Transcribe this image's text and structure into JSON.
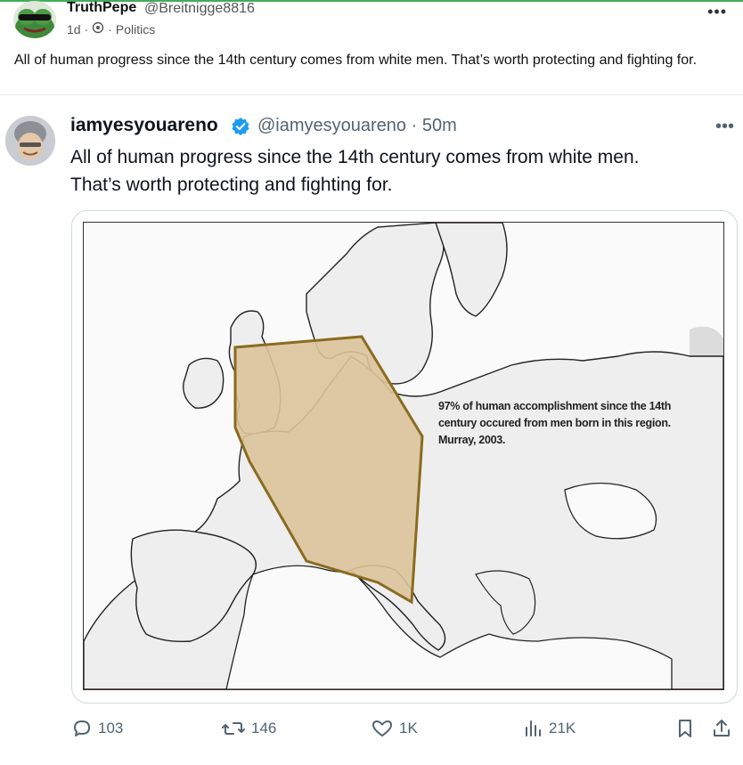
{
  "post": {
    "author_name": "TruthPepe",
    "author_handle": "@Breitnigge8816",
    "time": "1d",
    "community": "Politics",
    "text": "All of human progress since the 14th century comes from white men. That’s worth protecting and fighting for."
  },
  "quoted": {
    "display_name": "iamyesyouareno",
    "handle_time": "@iamyesyouareno · 50m",
    "text_line1": "All of human progress since the 14th century comes from white men.",
    "text_line2": "That’s worth protecting and fighting for.",
    "map_caption": [
      "97% of human accomplishment since the 14th",
      "century occured from men born in this region.",
      "Murray, 2003."
    ],
    "stats": {
      "replies": "103",
      "reposts": "146",
      "likes": "1K",
      "views": "21K"
    }
  },
  "icons": [
    "frog-avatar",
    "three-dots-icon",
    "community-icon",
    "verified-badge-icon",
    "reply-icon",
    "repost-icon",
    "like-icon",
    "views-icon",
    "bookmark-icon",
    "share-icon"
  ],
  "colors": {
    "highlight_fill": "#dcc39b",
    "highlight_stroke": "#8a6b1e",
    "verified_blue": "#1d9bf0",
    "land": "#eeeeee",
    "top_accent": "#3fae5a"
  }
}
